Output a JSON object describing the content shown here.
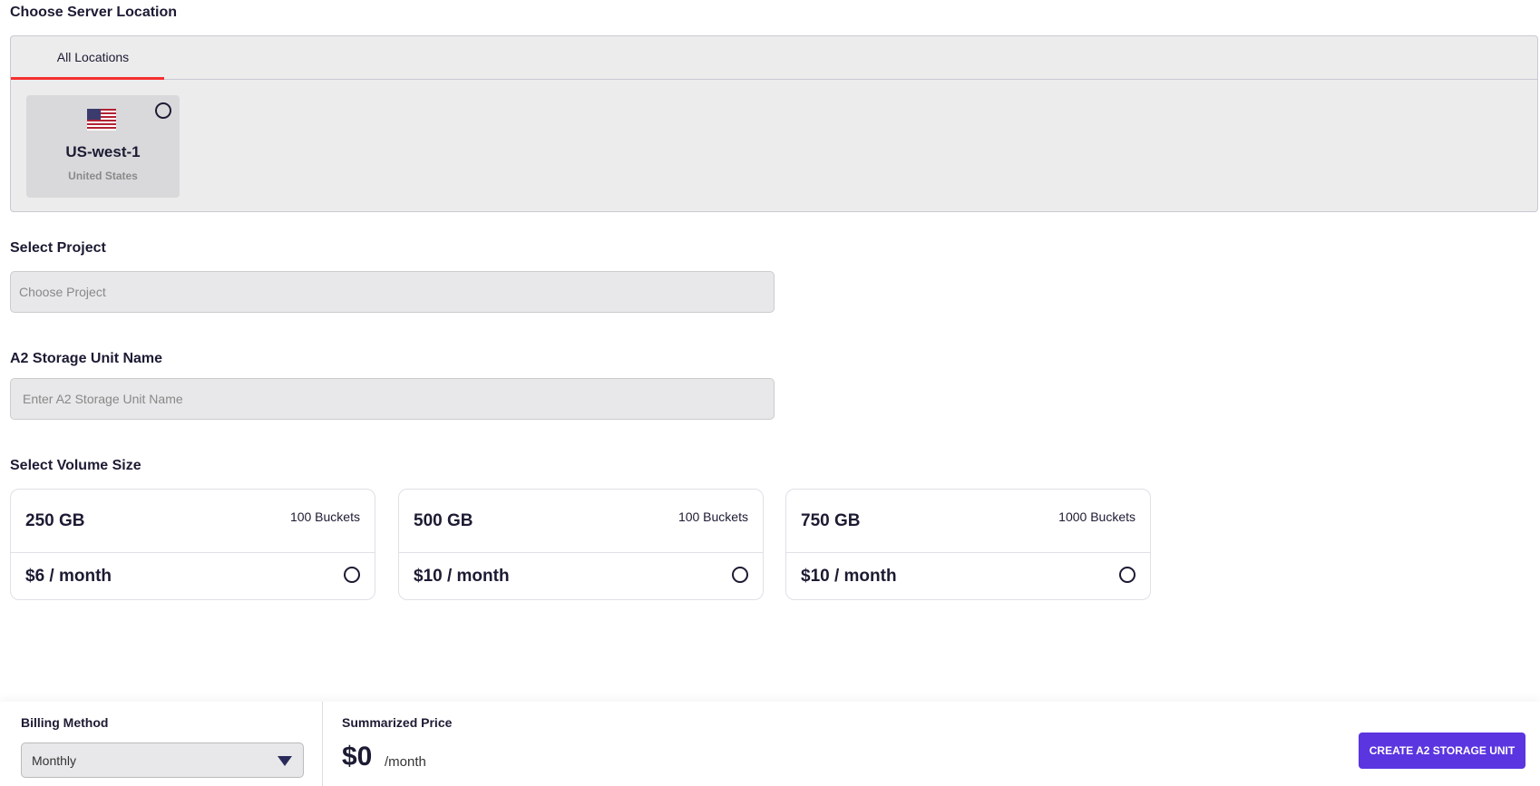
{
  "location": {
    "heading": "Choose Server Location",
    "tab": "All Locations",
    "card": {
      "name": "US-west-1",
      "country": "United States",
      "flag": "us-flag"
    }
  },
  "project": {
    "label": "Select Project",
    "placeholder": "Choose Project"
  },
  "name": {
    "label": "A2 Storage Unit Name",
    "placeholder": "Enter A2 Storage Unit Name"
  },
  "volume": {
    "label": "Select Volume Size",
    "options": [
      {
        "size": "250 GB",
        "buckets": "100 Buckets",
        "price": "$6 / month"
      },
      {
        "size": "500 GB",
        "buckets": "100 Buckets",
        "price": "$10 / month"
      },
      {
        "size": "750 GB",
        "buckets": "1000 Buckets",
        "price": "$10 / month"
      }
    ]
  },
  "footer": {
    "billing_label": "Billing Method",
    "billing_value": "Monthly",
    "price_label": "Summarized Price",
    "price": "$0",
    "price_unit": "/month",
    "create_button": "CREATE A2 STORAGE UNIT"
  },
  "colors": {
    "accent": "#5b35e0",
    "tab_underline": "#f52f2f"
  }
}
